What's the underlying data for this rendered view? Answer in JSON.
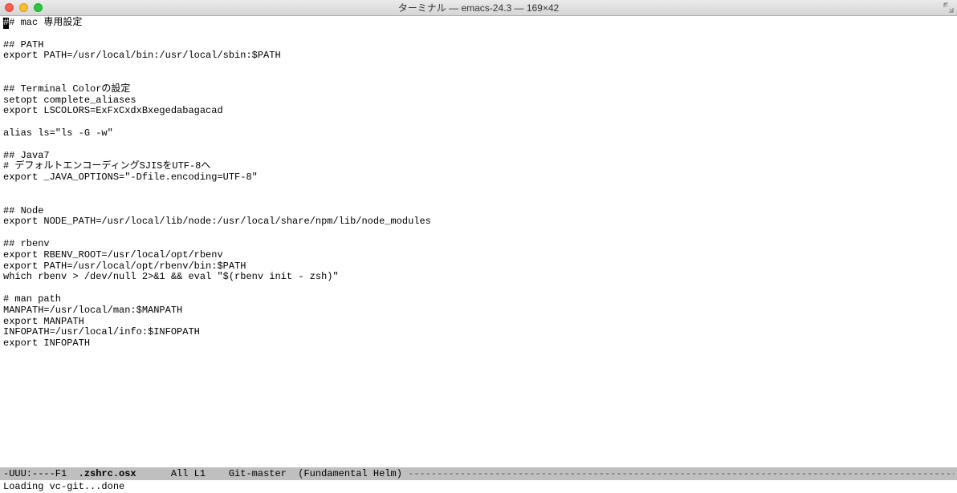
{
  "titlebar": {
    "title": "ターミナル — emacs-24.3 — 169×42"
  },
  "editor": {
    "cursor_char": "#",
    "lines": [
      "## mac 専用設定",
      "",
      "## PATH",
      "export PATH=/usr/local/bin:/usr/local/sbin:$PATH",
      "",
      "",
      "## Terminal Colorの設定",
      "setopt complete_aliases",
      "export LSCOLORS=ExFxCxdxBxegedabagacad",
      "",
      "alias ls=\"ls -G -w\"",
      "",
      "## Java7",
      "# デフォルトエンコーディングSJISをUTF-8へ",
      "export _JAVA_OPTIONS=\"-Dfile.encoding=UTF-8\"",
      "",
      "",
      "## Node",
      "export NODE_PATH=/usr/local/lib/node:/usr/local/share/npm/lib/node_modules",
      "",
      "## rbenv",
      "export RBENV_ROOT=/usr/local/opt/rbenv",
      "export PATH=/usr/local/opt/rbenv/bin:$PATH",
      "which rbenv > /dev/null 2>&1 && eval \"$(rbenv init - zsh)\"",
      "",
      "# man path",
      "MANPATH=/usr/local/man:$MANPATH",
      "export MANPATH",
      "INFOPATH=/usr/local/info:$INFOPATH",
      "export INFOPATH"
    ]
  },
  "modeline": {
    "prefix": "-UUU:----F1  ",
    "buffer_name": ".zshrc.osx",
    "mid": "      All L1    Git-master  (Fundamental Helm) ",
    "dashes": "----------------------------------------------------------------------------------------------------------------------------------------------------------------"
  },
  "minibuffer": {
    "text": "Loading vc-git...done"
  }
}
